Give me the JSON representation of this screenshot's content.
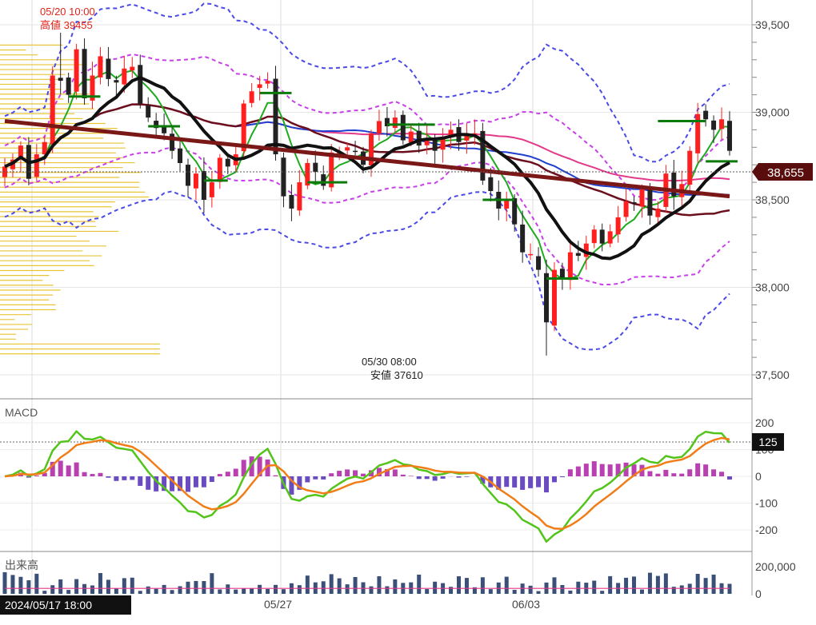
{
  "chart_data": [
    {
      "type": "candlestick",
      "panel": "price",
      "y_ticks": [
        "39,500",
        "39,000",
        "38,500",
        "38,000",
        "37,500"
      ],
      "y_tick_values": [
        39500,
        39000,
        38500,
        38000,
        37500
      ],
      "ylim": [
        37300,
        39650
      ],
      "x_labels": [
        "05/27",
        "06/03"
      ],
      "current_price_label": "38,655",
      "current_price": 38655,
      "high_annotation": {
        "time": "05/20 10:00",
        "label": "高値 39455",
        "value": 39455
      },
      "low_annotation": {
        "time": "05/30 08:00",
        "label": "安値 37610",
        "value": 37610
      },
      "candles": {
        "count": 92,
        "path": [
          38690,
          38730,
          38810,
          38620,
          38760,
          38830,
          39210,
          39180,
          39100,
          39360,
          39080,
          39210,
          39320,
          39190,
          39170,
          39250,
          39260,
          39050,
          38970,
          38910,
          38880,
          38780,
          38710,
          38580,
          38650,
          38500,
          38600,
          38740,
          38690,
          38760,
          39050,
          39120,
          39160,
          39180,
          38760,
          38520,
          38450,
          38600,
          38710,
          38660,
          38580,
          38770,
          38770,
          38800,
          38780,
          38700,
          38880,
          38950,
          38920,
          38970,
          38840,
          38890,
          38810,
          38850,
          38780,
          38860,
          38900,
          38830,
          38870,
          38880,
          38610,
          38550,
          38450,
          38500,
          38360,
          38200,
          38190,
          38100,
          37800,
          38100,
          38050,
          38200,
          38180,
          38250,
          38330,
          38250,
          38320,
          38400,
          38490,
          38480,
          38560,
          38410,
          38450,
          38650,
          38520,
          38590,
          38780,
          38990,
          38960,
          38900,
          38960,
          38780
        ],
        "up_color": "#ff1f1f",
        "down_color": "#222222"
      },
      "overlays": {
        "sma_short_color": "#1faa1f",
        "sma_mid_color": "#111111",
        "sma_long_color": "#6b0e1e",
        "trend_color": "#7a1717",
        "ma_blue_color": "#1f3fcf",
        "ma_pink_color": "#e2398a",
        "bb_outer_color": "#4a4ae6",
        "bb_inner_color": "#c840e8",
        "volume_profile_color": "#e8c437"
      }
    },
    {
      "type": "line",
      "panel": "macd",
      "title": "MACD",
      "y_ticks": [
        "200",
        "100",
        "0",
        "-100",
        "-200"
      ],
      "y_tick_values": [
        200,
        100,
        0,
        -100,
        -200
      ],
      "ylim": [
        -230,
        210
      ],
      "current_label": "125",
      "current_value": 125,
      "macd_color": "#52c41a",
      "signal_color": "#f07d18",
      "hist_pos_color": "#b840b0",
      "hist_neg_color": "#6a4cc0"
    },
    {
      "type": "bar",
      "panel": "volume",
      "title": "出来高",
      "y_ticks": [
        "200,000",
        "0"
      ],
      "y_tick_values": [
        200000,
        0
      ],
      "ylim": [
        0,
        240000
      ],
      "bar_color": "#3b5078"
    }
  ],
  "cursor_time_label": "2024/05/17 18:00"
}
